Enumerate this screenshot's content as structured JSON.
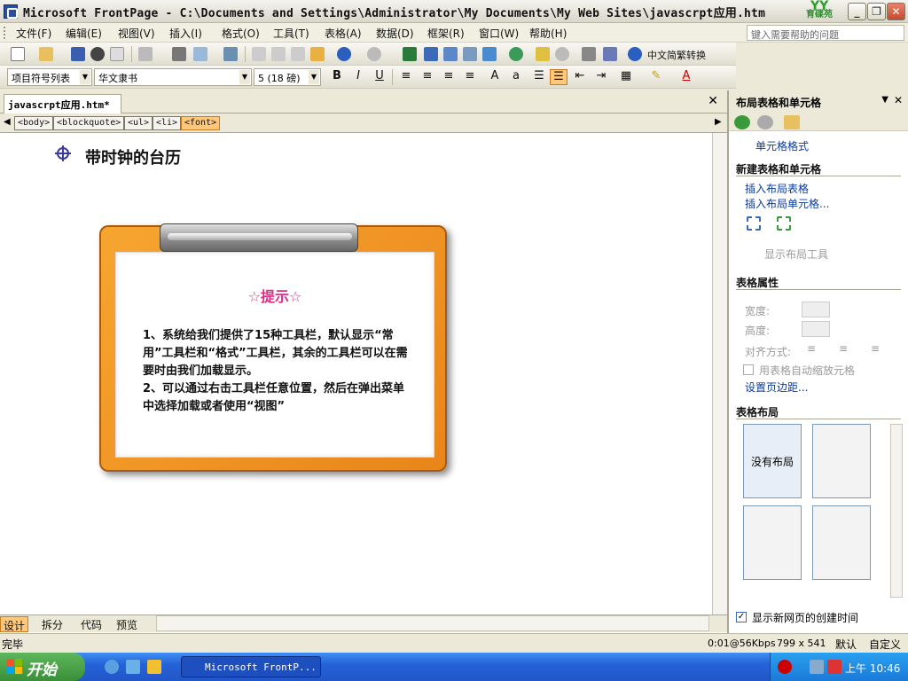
{
  "window": {
    "title": "Microsoft FrontPage - C:\\Documents and Settings\\Administrator\\My Documents\\My Web Sites\\javascrpt应用.htm",
    "brand": "育碟苑"
  },
  "menubar": {
    "items": [
      "文件(F)",
      "编辑(E)",
      "视图(V)",
      "插入(I)",
      "格式(O)",
      "工具(T)",
      "表格(A)",
      "数据(D)",
      "框架(R)",
      "窗口(W)",
      "帮助(H)"
    ],
    "help_placeholder": "键入需要帮助的问题"
  },
  "toolbar": {
    "convert_label": "中文简繁转换"
  },
  "format_toolbar": {
    "style": "项目符号列表",
    "font": "华文隶书",
    "size": "5 (18 磅)"
  },
  "document": {
    "tab": "javascrpt应用.htm*",
    "tags": [
      "<body>",
      "<blockquote>",
      "<ul>",
      "<li>",
      "<font>"
    ],
    "heading": "带时钟的台历"
  },
  "tip": {
    "title": "☆提示☆",
    "body": "1、系统给我们提供了15种工具栏，默认显示“常用”工具栏和“格式”工具栏，其余的工具栏可以在需要时由我们加载显示。\n2、可以通过右击工具栏任意位置，然后在弹出菜单中选择加载或者使用“视图”"
  },
  "view_tabs": [
    "设计",
    "拆分",
    "代码",
    "预览"
  ],
  "task_pane": {
    "title": "布局表格和单元格",
    "cell_format": "单元格格式",
    "new_section": "新建表格和单元格",
    "insert_table": "插入布局表格",
    "insert_cell": "插入布局单元格...",
    "show_tool": "显示布局工具",
    "props_section": "表格属性",
    "width": "宽度:",
    "height": "高度:",
    "align": "对齐方式:",
    "autoscale": "用表格自动缩放元格",
    "margins": "设置页边距...",
    "layout_section": "表格布局",
    "no_layout": "没有布局",
    "show_date": "显示新网页的创建时间"
  },
  "statusbar": {
    "left": "完毕",
    "speed": "0:01@56Kbps",
    "size": "799 x 541",
    "mode": "默认",
    "custom": "自定义"
  },
  "taskbar": {
    "start": "开始",
    "task": "Microsoft FrontP...",
    "time": "上午 10:46"
  }
}
